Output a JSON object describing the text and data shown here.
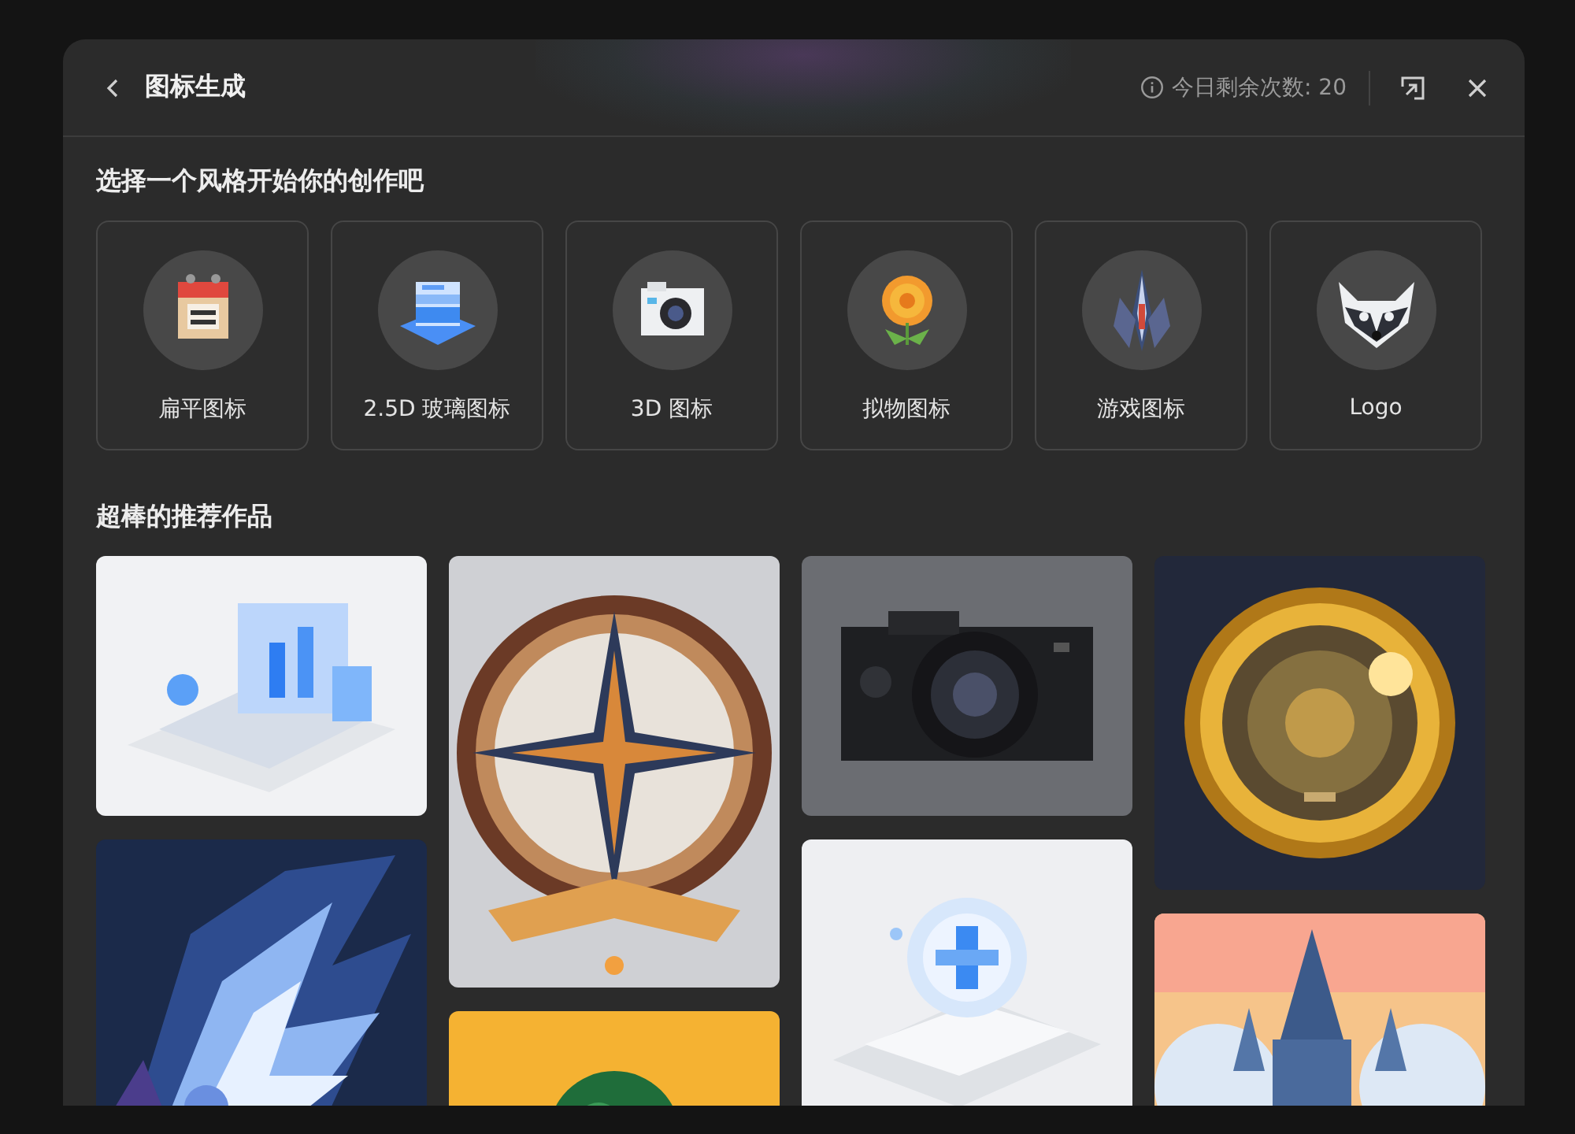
{
  "window": {
    "title": "图标生成",
    "remaining": "今日剩余次数: 20"
  },
  "styles_section": {
    "heading": "选择一个风格开始你的创作吧",
    "styles": [
      {
        "label": "扁平图标"
      },
      {
        "label": "2.5D 玻璃图标"
      },
      {
        "label": "3D 图标"
      },
      {
        "label": "拟物图标"
      },
      {
        "label": "游戏图标"
      },
      {
        "label": "Logo"
      }
    ]
  },
  "gallery": {
    "heading": "超棒的推荐作品"
  }
}
